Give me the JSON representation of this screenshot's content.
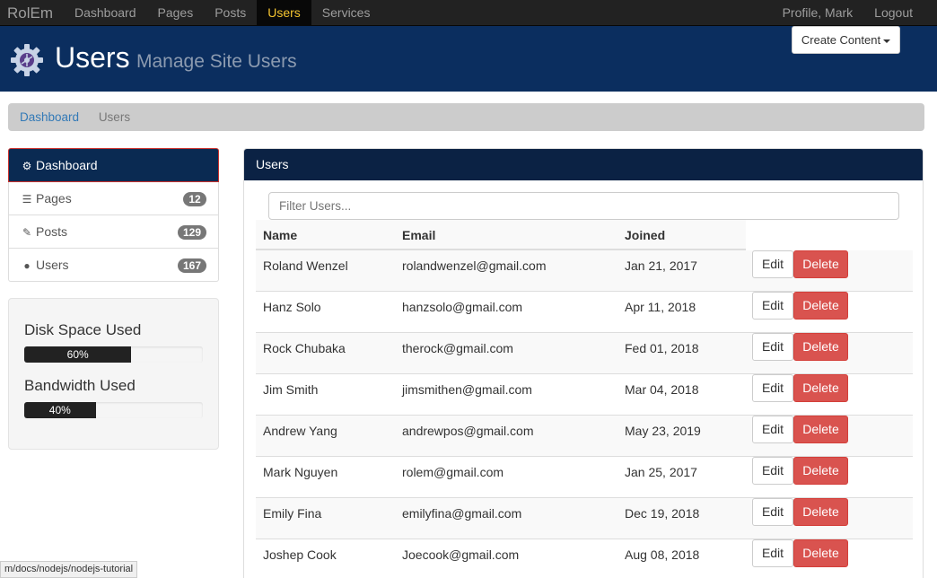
{
  "navbar": {
    "brand": "RolEm",
    "left": [
      "Dashboard",
      "Pages",
      "Posts",
      "Users",
      "Services"
    ],
    "active": "Users",
    "right": [
      "Profile, Mark",
      "Logout"
    ]
  },
  "header": {
    "title": "Users",
    "subtitle": "Manage Site Users",
    "create_button": "Create Content",
    "logo_icon": "gear-icon"
  },
  "breadcrumb": {
    "link": "Dashboard",
    "active": "Users"
  },
  "sidebar": {
    "items": [
      {
        "label": "Dashboard",
        "icon": "gear-icon",
        "badge": ""
      },
      {
        "label": "Pages",
        "icon": "list-icon",
        "badge": "12"
      },
      {
        "label": "Posts",
        "icon": "pencil-icon",
        "badge": "129"
      },
      {
        "label": "Users",
        "icon": "user-icon",
        "badge": "167"
      }
    ],
    "disk": {
      "label": "Disk Space Used",
      "percent_text": "60%",
      "value": 0.6
    },
    "bandwidth": {
      "label": "Bandwidth Used",
      "percent_text": "40%",
      "value": 0.4
    }
  },
  "panel": {
    "title": "Users",
    "filter_placeholder": "Filter Users...",
    "columns": [
      "Name",
      "Email",
      "Joined"
    ],
    "edit_label": "Edit",
    "delete_label": "Delete",
    "rows": [
      {
        "name": "Roland Wenzel",
        "email": "rolandwenzel@gmail.com",
        "joined": "Jan 21, 2017"
      },
      {
        "name": "Hanz Solo",
        "email": "hanzsolo@gmail.com",
        "joined": "Apr 11, 2018"
      },
      {
        "name": "Rock Chubaka",
        "email": "therock@gmail.com",
        "joined": "Fed 01, 2018"
      },
      {
        "name": "Jim Smith",
        "email": "jimsmithen@gmail.com",
        "joined": "Mar 04, 2018"
      },
      {
        "name": "Andrew Yang",
        "email": "andrewpos@gmail.com",
        "joined": "May 23, 2019"
      },
      {
        "name": "Mark Nguyen",
        "email": "rolem@gmail.com",
        "joined": "Jan 25, 2017"
      },
      {
        "name": "Emily Fina",
        "email": "emilyfina@gmail.com",
        "joined": "Dec 19, 2018"
      },
      {
        "name": "Joshep Cook",
        "email": "Joecook@gmail.com",
        "joined": "Aug 08, 2018"
      }
    ]
  },
  "status_url": "m/docs/nodejs/nodejs-tutorial",
  "colors": {
    "navbar": "#222222",
    "header": "#0b2e5f",
    "active_nav": "#f4c430",
    "delete": "#d9534f",
    "link": "#337ab7"
  }
}
